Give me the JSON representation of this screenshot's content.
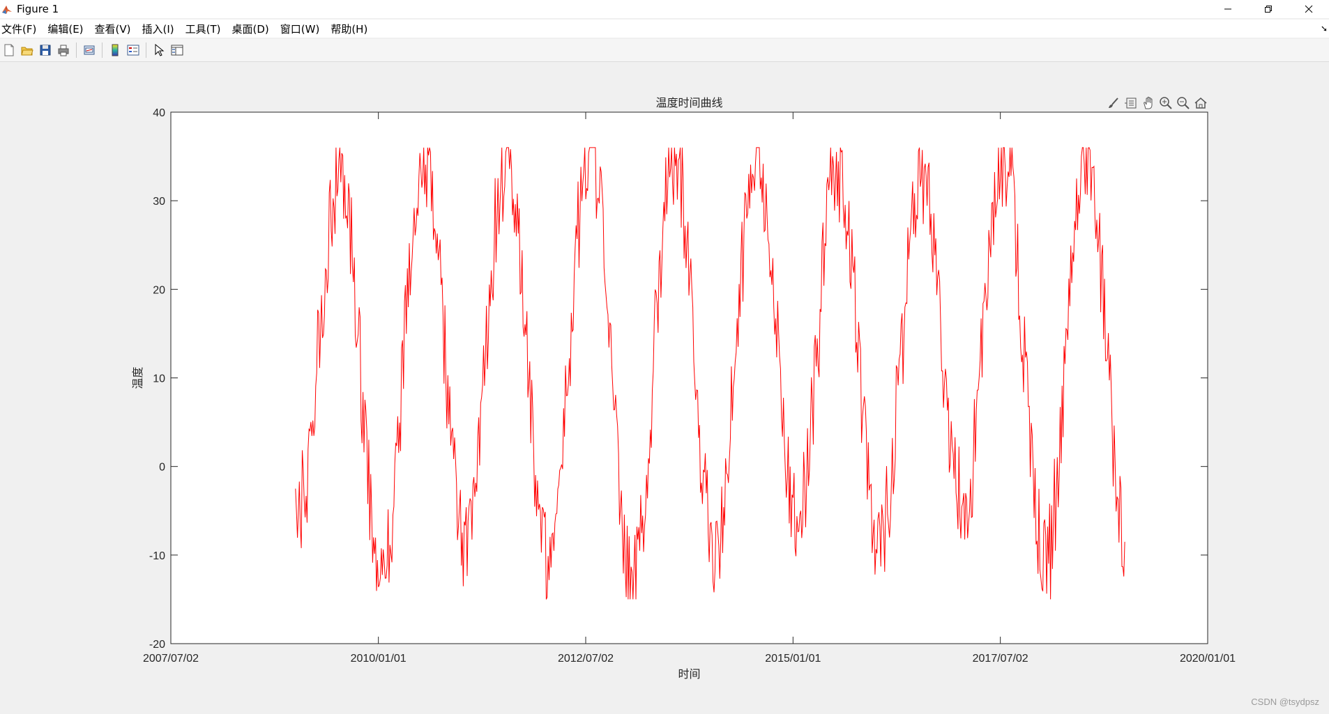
{
  "window": {
    "title": "Figure 1"
  },
  "menu": [
    {
      "label": "文件(F)"
    },
    {
      "label": "编辑(E)"
    },
    {
      "label": "查看(V)"
    },
    {
      "label": "插入(I)"
    },
    {
      "label": "工具(T)"
    },
    {
      "label": "桌面(D)"
    },
    {
      "label": "窗口(W)"
    },
    {
      "label": "帮助(H)"
    }
  ],
  "toolbar_icons": [
    "new-figure-icon",
    "open-file-icon",
    "save-icon",
    "print-icon",
    "link-plot-icon",
    "insert-colorbar-icon",
    "insert-legend-icon",
    "edit-plot-icon",
    "property-inspector-icon"
  ],
  "axes_toolbar_icons": [
    "brush-icon",
    "datatip-icon",
    "pan-icon",
    "zoom-in-icon",
    "zoom-out-icon",
    "restore-view-icon"
  ],
  "watermark": "CSDN @tsydpsz",
  "colors": {
    "line": "#ff0000",
    "axis": "#262626",
    "figure_bg": "#f0f0f0",
    "axes_bg": "#ffffff"
  },
  "chart_data": {
    "type": "line",
    "title": "温度时间曲线",
    "xlabel": "时间",
    "ylabel": "温度",
    "xlim": [
      "2007/07/02",
      "2020/01/01"
    ],
    "ylim": [
      -20,
      40
    ],
    "xticks": [
      "2007/07/02",
      "2010/01/01",
      "2012/07/02",
      "2015/01/01",
      "2017/07/02",
      "2020/01/01"
    ],
    "yticks": [
      -20,
      -10,
      0,
      10,
      20,
      30,
      40
    ],
    "grid": false,
    "series": [
      {
        "color": "#ff0000",
        "x_start": "2009/01/01",
        "x_end": "2019/01/01",
        "peaks": [
          "2009/07/15",
          "2010/07/20",
          "2011/07/18",
          "2012/07/25",
          "2013/07/22",
          "2014/07/20",
          "2015/07/18",
          "2016/07/22",
          "2017/07/20",
          "2018/07/15"
        ],
        "maxima": [
          33,
          35,
          33.5,
          35.5,
          34.5,
          35,
          34,
          33,
          35,
          35
        ],
        "minima": [
          -4.5,
          -12,
          -8.5,
          -10.5,
          -13.5,
          -9.5,
          -6,
          -9,
          -5,
          -11,
          -9.5
        ],
        "start_value": -2.5,
        "end_value": -8.5
      }
    ]
  }
}
